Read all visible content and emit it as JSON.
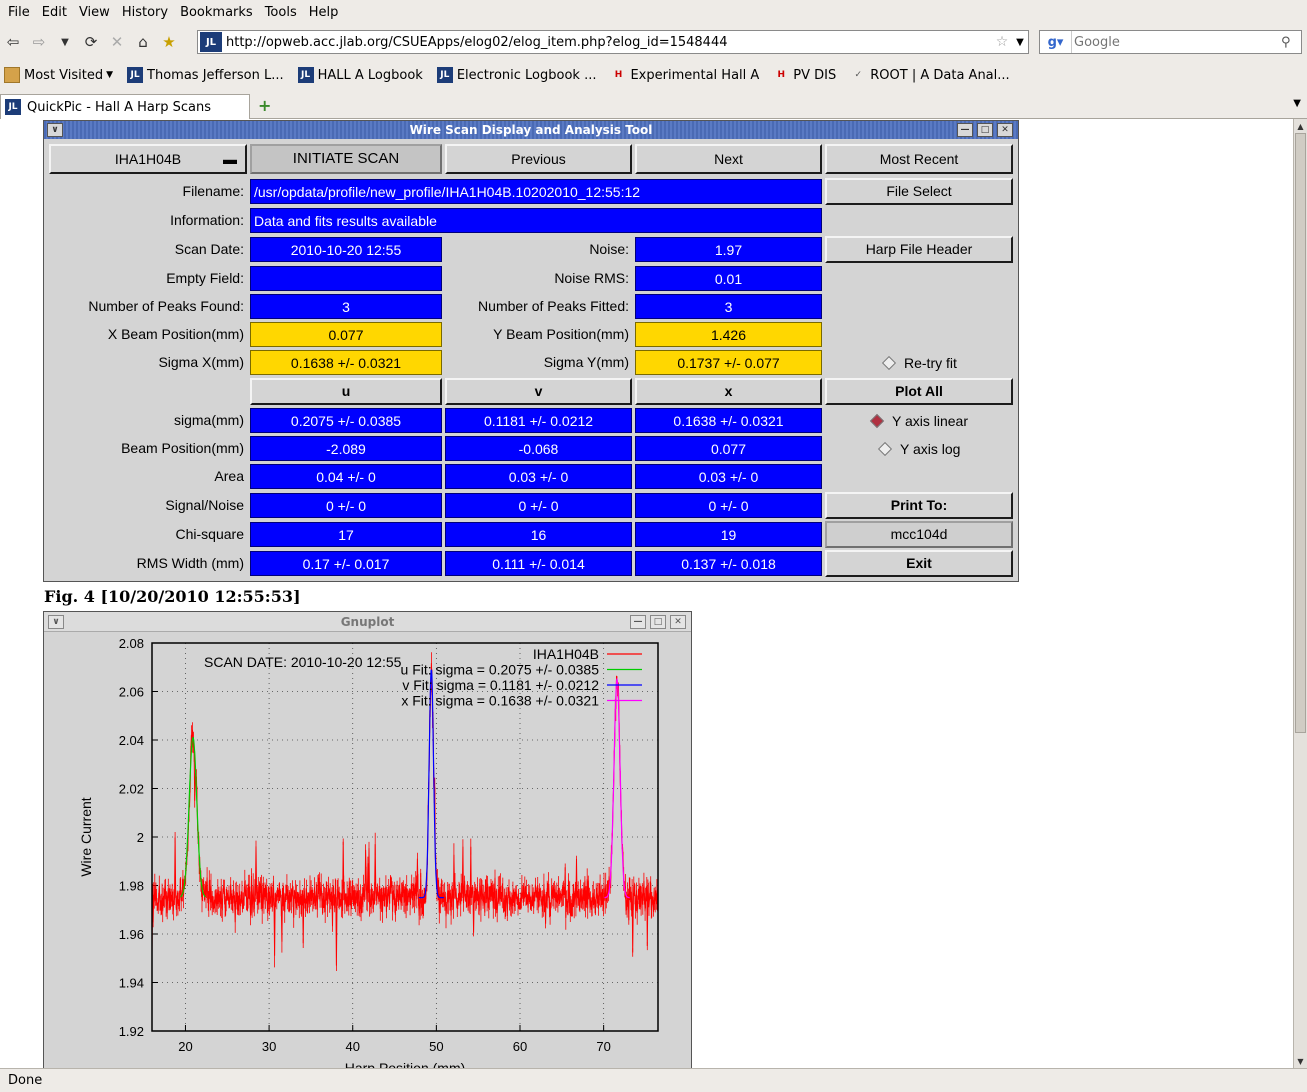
{
  "browser": {
    "menu": [
      "File",
      "Edit",
      "View",
      "History",
      "Bookmarks",
      "Tools",
      "Help"
    ],
    "url": "http://opweb.acc.jlab.org/CSUEApps/elog02/elog_item.php?elog_id=1548444",
    "search_placeholder": "Google",
    "bookmarks": [
      "Most Visited",
      "Thomas Jefferson L...",
      "HALL A Logbook",
      "Electronic Logbook ...",
      "Experimental Hall A",
      "PV DIS",
      "ROOT | A Data Anal..."
    ],
    "tab_title": "QuickPic - Hall A Harp Scans",
    "status": "Done",
    "icons": {
      "back": "back-arrow-icon",
      "forward": "forward-arrow-icon",
      "reload": "reload-icon",
      "stop": "stop-icon",
      "home": "home-icon"
    }
  },
  "tool": {
    "title": "Wire Scan Display and Analysis Tool",
    "harp_select": "IHA1H04B",
    "buttons": {
      "initiate": "INITIATE SCAN",
      "previous": "Previous",
      "next": "Next",
      "most_recent": "Most Recent",
      "file_select": "File Select",
      "harp_header": "Harp File Header",
      "plot_all": "Plot All",
      "print_to": "Print To:",
      "printer": "mcc104d",
      "exit": "Exit"
    },
    "labels": {
      "filename": "Filename:",
      "information": "Information:",
      "scan_date": "Scan Date:",
      "empty_field": "Empty Field:",
      "peaks_found": "Number of Peaks Found:",
      "x_beam": "X Beam Position(mm)",
      "sigma_x": "Sigma X(mm)",
      "noise": "Noise:",
      "noise_rms": "Noise RMS:",
      "peaks_fitted": "Number of Peaks Fitted:",
      "y_beam": "Y Beam Position(mm)",
      "sigma_y": "Sigma Y(mm)"
    },
    "values": {
      "filename": "/usr/opdata/profile/new_profile/IHA1H04B.10202010_12:55:12",
      "information": "Data and fits results available",
      "scan_date": "2010-10-20   12:55",
      "empty_field": "",
      "peaks_found": "3",
      "x_beam": "0.077",
      "sigma_x": "0.1638 +/- 0.0321",
      "noise": "1.97",
      "noise_rms": "0.01",
      "peaks_fitted": "3",
      "y_beam": "1.426",
      "sigma_y": "0.1737 +/- 0.077"
    },
    "options": {
      "retry": "Re-try fit",
      "y_linear": "Y axis linear",
      "y_log": "Y axis log",
      "selected_scale": "linear"
    },
    "columns": [
      "u",
      "v",
      "x"
    ],
    "rows": [
      {
        "label": "sigma(mm)",
        "values": [
          "0.2075 +/- 0.0385",
          "0.1181 +/- 0.0212",
          "0.1638 +/- 0.0321"
        ]
      },
      {
        "label": "Beam Position(mm)",
        "values": [
          "-2.089",
          "-0.068",
          "0.077"
        ]
      },
      {
        "label": "Area",
        "values": [
          "0.04 +/- 0",
          "0.03 +/- 0",
          "0.03 +/- 0"
        ]
      },
      {
        "label": "Signal/Noise",
        "values": [
          "0 +/- 0",
          "0 +/- 0",
          "0 +/- 0"
        ]
      },
      {
        "label": "Chi-square",
        "values": [
          "17",
          "16",
          "19"
        ]
      },
      {
        "label": "RMS Width (mm)",
        "values": [
          "0.17 +/- 0.017",
          "0.111 +/- 0.014",
          "0.137 +/- 0.018"
        ]
      }
    ]
  },
  "figure_caption": "Fig. 4 [10/20/2010 12:55:53]",
  "gnuplot_title": "Gnuplot",
  "chart_data": {
    "type": "line",
    "annotation": "SCAN DATE: 2010-10-20   12:55",
    "ylabel": "Wire Current",
    "xlabel": "Harp Position (mm)",
    "xlim": [
      16,
      76.5
    ],
    "ylim": [
      1.92,
      2.08
    ],
    "xticks": [
      20,
      30,
      40,
      50,
      60,
      70
    ],
    "yticks": [
      1.92,
      1.94,
      1.96,
      1.98,
      2.0,
      2.02,
      2.04,
      2.06,
      2.08
    ],
    "ytick_labels": [
      "1.92",
      "1.94",
      "1.96",
      "1.98",
      "2",
      "2.02",
      "2.04",
      "2.06",
      "2.08"
    ],
    "grid": true,
    "legend_position": "top-right",
    "baseline": 1.975,
    "series": [
      {
        "name": "IHA1H04B",
        "color": "#ff0000",
        "kind": "data"
      },
      {
        "name": "u  Fit: sigma = 0.2075 +/- 0.0385",
        "color": "#00cc00",
        "kind": "fit",
        "center": 20.9,
        "sigma": 0.2075,
        "amplitude": 0.066
      },
      {
        "name": "v  Fit: sigma = 0.1181 +/- 0.0212",
        "color": "#0000ff",
        "kind": "fit",
        "center": 49.4,
        "sigma": 0.1181,
        "amplitude": 0.094
      },
      {
        "name": "x  Fit: sigma = 0.1638 +/- 0.0321",
        "color": "#ff00ff",
        "kind": "fit",
        "center": 71.6,
        "sigma": 0.1638,
        "amplitude": 0.09
      }
    ]
  },
  "colors": {
    "field_blue": "#0000ff",
    "field_yellow": "#ffd700",
    "panel_gray": "#d4d4d4"
  }
}
